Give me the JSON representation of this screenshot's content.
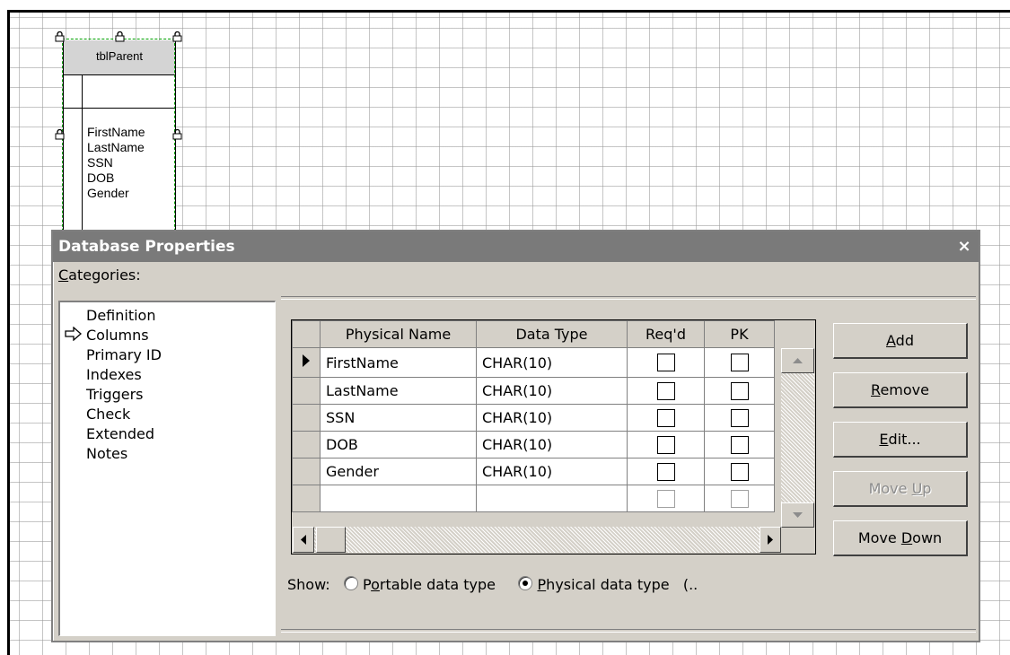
{
  "entity": {
    "title": "tblParent",
    "attributes": [
      "FirstName",
      "LastName",
      "SSN",
      "DOB",
      "Gender"
    ]
  },
  "dialog": {
    "title": "Database Properties",
    "close_label": "×",
    "categories_label_accel": "C",
    "categories_label_rest": "ategories:",
    "categories": [
      "Definition",
      "Columns",
      "Primary ID",
      "Indexes",
      "Triggers",
      "Check",
      "Extended",
      "Notes"
    ],
    "selected_category": "Columns",
    "selected_category_icon": "right-arrow-icon",
    "grid": {
      "headers": [
        "Physical Name",
        "Data Type",
        "Req'd",
        "PK"
      ],
      "rows": [
        {
          "name": "FirstName",
          "type": "CHAR(10)",
          "current": true
        },
        {
          "name": "LastName",
          "type": "CHAR(10)"
        },
        {
          "name": "SSN",
          "type": "CHAR(10)"
        },
        {
          "name": "DOB",
          "type": "CHAR(10)"
        },
        {
          "name": "Gender",
          "type": "CHAR(10)"
        },
        {
          "name": "",
          "type": ""
        }
      ]
    },
    "buttons": {
      "add": {
        "accel": "A",
        "rest": "dd",
        "disabled": false
      },
      "remove": {
        "accel": "R",
        "rest": "emove",
        "disabled": false
      },
      "edit": {
        "accel": "E",
        "rest": "dit...",
        "disabled": false
      },
      "move_up": {
        "pre": "Move ",
        "accel": "U",
        "rest": "p",
        "disabled": true
      },
      "move_down": {
        "pre": "Move ",
        "accel": "D",
        "rest": "own",
        "disabled": false
      }
    },
    "show": {
      "label": "Show:",
      "portable": {
        "pre": "P",
        "accel": "o",
        "rest": "rtable data type",
        "selected": false
      },
      "physical": {
        "accel": "P",
        "rest": "hysical data type",
        "suffix": "(..",
        "selected": true
      }
    }
  },
  "colors": {
    "dialog_bg": "#d4d0c8",
    "titlebar_bg": "#7a7a7a",
    "selection_outline": "#00a000"
  }
}
